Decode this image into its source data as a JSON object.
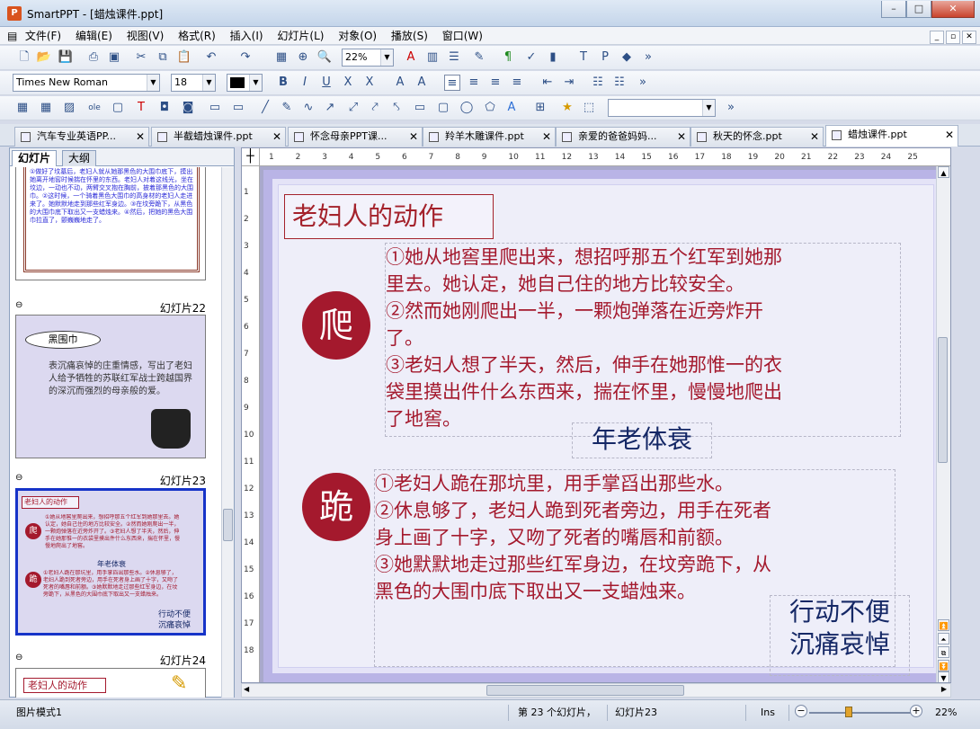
{
  "window": {
    "title": "SmartPPT - [蜡烛课件.ppt]",
    "minimize": "–",
    "maximize": "□",
    "close": "✕"
  },
  "menu": {
    "items": [
      "文件(F)",
      "编辑(E)",
      "视图(V)",
      "格式(R)",
      "插入(I)",
      "幻灯片(L)",
      "对象(O)",
      "播放(S)",
      "窗口(W)"
    ]
  },
  "toolbar": {
    "zoom": "22%",
    "font": "Times New Roman",
    "size": "18",
    "more": "»"
  },
  "tabs": [
    {
      "label": "汽车专业英语PP..."
    },
    {
      "label": "半截蜡烛课件.ppt"
    },
    {
      "label": "怀念母亲PPT课..."
    },
    {
      "label": "羚羊木雕课件.ppt"
    },
    {
      "label": "亲爱的爸爸妈妈..."
    },
    {
      "label": "秋天的怀念.ppt"
    },
    {
      "label": "蜡烛课件.ppt"
    }
  ],
  "left_panel": {
    "tabs": [
      "幻灯片",
      "大纲"
    ],
    "thumb_prev_text": "①做好了坟墓后，老妇人就从她那黑色的大围巾底下，摸出她离开地窖时候揣在怀里的东西。老妇人对着这线光，坐在坟边，一动也不动，两臂交叉抱在胸前，披着那黑色的大围巾。②这时候，一个骑着黑色大围巾的高身材的老妇人走进来了。她默默地走到那些红军身边。③在坟旁跪下，从黑色的大围巾底下取出又一支蜡烛来。④然后，把她的黑色大围巾拉直了，颤巍巍地走了。",
    "slides": [
      {
        "label": "幻灯片22",
        "oval": "黑围巾",
        "text": "表沉痛哀悼的庄重情感，写出了老妇人给予牺牲的苏联红军战士跨越国界的深沉而强烈的母亲般的爱。"
      },
      {
        "label": "幻灯片23",
        "title": "老妇人的动作",
        "c1": "爬",
        "c2": "跪",
        "t1": "①她从地窖里爬出来，想招呼那五个红军到她那里去。她认定，她自己住的地方比较安全。②然而她刚爬出一半，一颗炮弹落在近旁炸开了。③老妇人想了半天，然后，伸手在她那惟一的衣袋里摸出件什么东西来，揣在怀里，慢慢地爬出了地窖。",
        "n1": "年老体衰",
        "t2": "①老妇人跪在那坑里，用手掌舀出那些水。②休息够了，老妇人跪到死者旁边，用手在死者身上画了十字，又吻了死者的嘴唇和前额。③她默默地走过那些红军身边，在坟旁跪下，从黑色的大围巾底下取出又一支蜡烛来。",
        "n2a": "行动不便",
        "n2b": "沉痛哀悼"
      },
      {
        "label": "幻灯片24",
        "title": "老妇人的动作"
      }
    ]
  },
  "slide": {
    "title": "老妇人的动作",
    "circle1": "爬",
    "circle2": "跪",
    "para1": [
      "①她从地窖里爬出来，想招呼那五个红军到她那",
      "里去。她认定，她自己住的地方比较安全。",
      "②然而她刚爬出一半，一颗炮弹落在近旁炸开",
      "了。",
      "③老妇人想了半天，然后，伸手在她那惟一的衣",
      "袋里摸出件什么东西来，揣在怀里，慢慢地爬出",
      "了地窖。"
    ],
    "note1": "年老体衰",
    "para2": [
      "①老妇人跪在那坑里，用手掌舀出那些水。",
      "②休息够了，老妇人跪到死者旁边，用手在死者",
      "身上画了十字，又吻了死者的嘴唇和前额。",
      "③她默默地走过那些红军身边，在坟旁跪下，从",
      "黑色的大围巾底下取出又一支蜡烛来。"
    ],
    "note2": [
      "行动不便",
      "沉痛哀悼"
    ]
  },
  "ruler": {
    "h": [
      "1",
      "2",
      "3",
      "4",
      "5",
      "6",
      "7",
      "8",
      "9",
      "10",
      "11",
      "12",
      "13",
      "14",
      "15",
      "16",
      "17",
      "18",
      "19",
      "20",
      "21",
      "22",
      "23",
      "24",
      "25"
    ],
    "v": [
      "1",
      "2",
      "3",
      "4",
      "5",
      "6",
      "7",
      "8",
      "9",
      "10",
      "11",
      "12",
      "13",
      "14",
      "15",
      "16",
      "17",
      "18"
    ]
  },
  "status": {
    "mode": "图片模式1",
    "count": "第 23 个幻灯片，",
    "current": "幻灯片23",
    "ins": "Ins",
    "zoom": "22%"
  }
}
